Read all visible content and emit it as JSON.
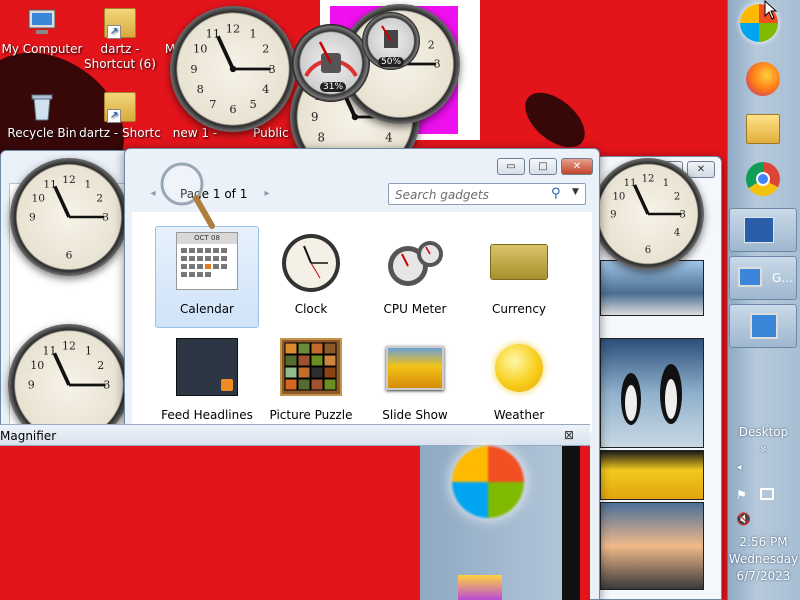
{
  "desktop": {
    "icons": [
      {
        "label": "My Computer",
        "icon": "computer-icon"
      },
      {
        "label": "dartz - Shortcut (6)",
        "icon": "folder-shortcut-icon"
      },
      {
        "label": "M",
        "icon": "media-icon"
      },
      {
        "label": "Recycle Bin",
        "icon": "recycle-bin-icon"
      },
      {
        "label": "dartz - Shortc",
        "icon": "folder-shortcut-icon"
      },
      {
        "label": "new 1 -",
        "icon": "file-icon"
      },
      {
        "label": "Public -",
        "icon": "folder-icon"
      }
    ]
  },
  "cpu_meter": {
    "cpu": "31%",
    "memory": "50%"
  },
  "gallery": {
    "page_label": "Page 1 of 1",
    "search_placeholder": "Search gadgets",
    "calendar_month": "OCT 08",
    "gadgets": [
      {
        "label": "Calendar",
        "icon": "calendar-icon",
        "selected": true
      },
      {
        "label": "Clock",
        "icon": "clock-icon"
      },
      {
        "label": "CPU Meter",
        "icon": "cpu-meter-icon"
      },
      {
        "label": "Currency",
        "icon": "currency-icon"
      },
      {
        "label": "Feed Headlines",
        "icon": "feed-icon"
      },
      {
        "label": "Picture Puzzle",
        "icon": "puzzle-icon"
      },
      {
        "label": "Slide Show",
        "icon": "slideshow-icon"
      },
      {
        "label": "Weather",
        "icon": "weather-icon"
      }
    ],
    "min_label": "▭",
    "max_label": "□",
    "close_label": "✕"
  },
  "magnifier": {
    "title": "Magnifier",
    "close_label": "⊠"
  },
  "taskbar": {
    "desktop_label": "Desktop",
    "chevron_label": "»",
    "time": "2:56 PM",
    "day": "Wednesday",
    "date": "6/7/2023",
    "running_label": "G...",
    "tray_arrow": "◂"
  }
}
